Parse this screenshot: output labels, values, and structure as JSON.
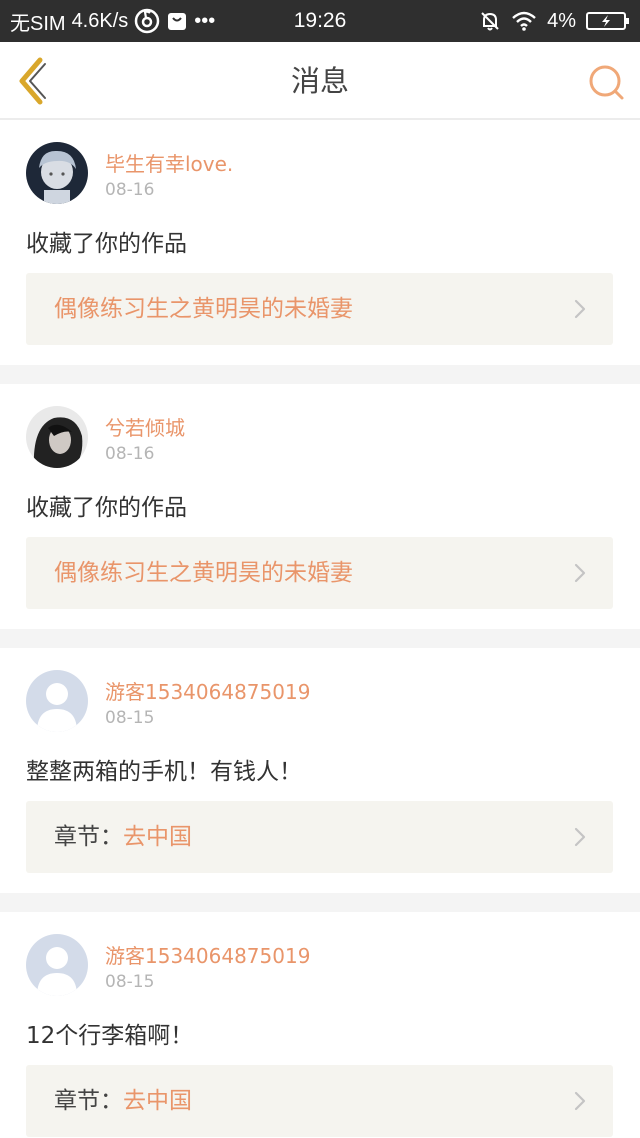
{
  "status_bar": {
    "carrier": "无SIM",
    "speed": "4.6K/s",
    "dots": "•••",
    "time": "19:26",
    "battery_percent": "4%",
    "icons": [
      "netease-music-icon",
      "bag-icon",
      "mute-bell-icon",
      "wifi-icon",
      "battery-charging-icon"
    ]
  },
  "nav": {
    "title": "消息",
    "back_icon": "back-chevron-icon",
    "search_icon": "search-icon"
  },
  "colors": {
    "accent": "#e9956a",
    "back_icon": "#d9a72b",
    "link_bg": "#f5f4ef",
    "separator": "#f4f4f4"
  },
  "messages": [
    {
      "username": "毕生有幸love.",
      "date": "08-16",
      "text": "收藏了你的作品",
      "link_prefix": "",
      "link_title": "偶像练习生之黄明昊的未婚妻",
      "avatar": "photo-avatar-1"
    },
    {
      "username": "兮若倾城",
      "date": "08-16",
      "text": "收藏了你的作品",
      "link_prefix": "",
      "link_title": "偶像练习生之黄明昊的未婚妻",
      "avatar": "photo-avatar-2"
    },
    {
      "username": "游客1534064875019",
      "date": "08-15",
      "text": "整整两箱的手机！有钱人！",
      "link_prefix": "章节：",
      "link_title": "去中国",
      "avatar": "default-user-icon"
    },
    {
      "username": "游客1534064875019",
      "date": "08-15",
      "text": "12个行李箱啊！",
      "link_prefix": "章节：",
      "link_title": "去中国",
      "avatar": "default-user-icon"
    }
  ]
}
